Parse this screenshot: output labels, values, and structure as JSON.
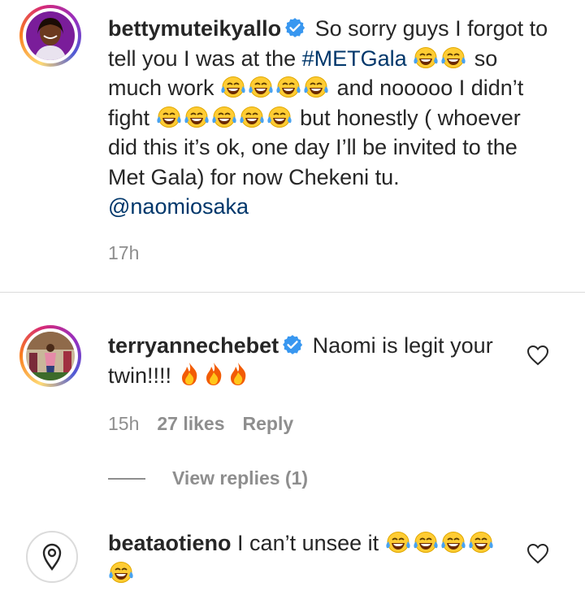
{
  "comments": [
    {
      "username": "bettymuteikyallo",
      "verified": true,
      "text_parts": {
        "a": "So sorry guys I forgot to tell you I was at the",
        "hashtag": "#METGala",
        "b": "so much work",
        "c": "and nooooo I didn’t fight",
        "d": "but honestly ( whoever did this it’s ok, one day I’ll be invited to the Met Gala) for now Chekeni tu.",
        "mention": "@naomiosaka"
      },
      "time": "17h"
    },
    {
      "username": "terryannechebet",
      "verified": true,
      "text": "Naomi is legit your twin!!!!",
      "time": "15h",
      "likes": "27 likes",
      "reply_label": "Reply",
      "view_replies": "View replies (1)"
    },
    {
      "username": "beataotieno",
      "verified": false,
      "text": "I can’t unsee it"
    }
  ],
  "icons": {
    "verified": "verified-badge-icon",
    "laugh": "tears-of-joy-emoji",
    "fire": "fire-emoji",
    "like": "heart-outline-icon",
    "location": "location-pin-icon"
  },
  "colors": {
    "link": "#00376b",
    "verified": "#3897f0",
    "meta": "#8e8e8e",
    "text": "#262626"
  }
}
